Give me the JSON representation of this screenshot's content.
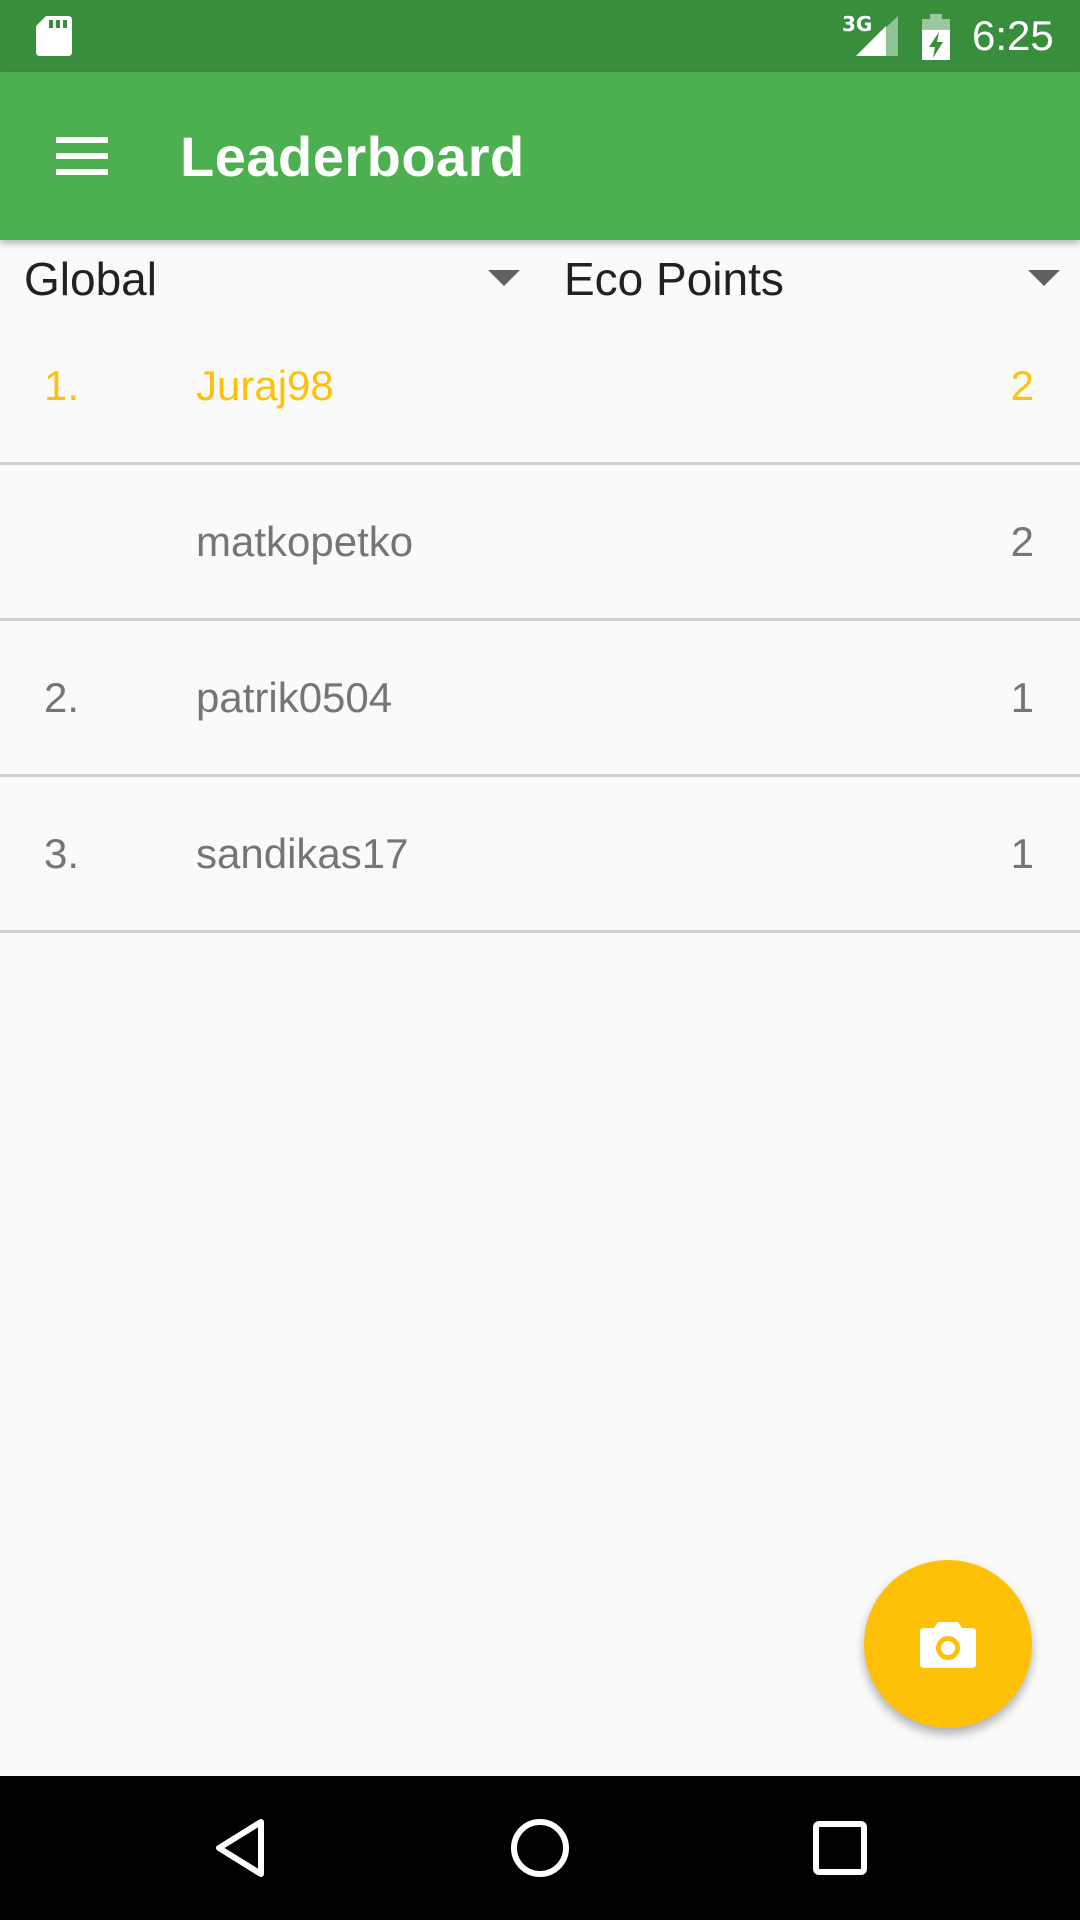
{
  "status_bar": {
    "network_type": "3G",
    "time": "6:25",
    "icons": [
      "sd-card-icon",
      "signal-icon",
      "battery-charging-icon"
    ]
  },
  "app_bar": {
    "title": "Leaderboard",
    "menu_icon": "menu-icon"
  },
  "filters": {
    "scope": {
      "selected": "Global"
    },
    "metric": {
      "selected": "Eco Points"
    }
  },
  "leaderboard": {
    "rows": [
      {
        "rank": "1.",
        "username": "Juraj98",
        "points": "2",
        "highlighted": true
      },
      {
        "rank": "",
        "username": "matkopetko",
        "points": "2",
        "highlighted": false
      },
      {
        "rank": "2.",
        "username": "patrik0504",
        "points": "1",
        "highlighted": false
      },
      {
        "rank": "3.",
        "username": "sandikas17",
        "points": "1",
        "highlighted": false
      }
    ]
  },
  "fab": {
    "icon": "camera-icon"
  },
  "navigation_bar": {
    "buttons": [
      "back-icon",
      "home-icon",
      "recents-icon"
    ]
  },
  "colors": {
    "status_bar": "#388e3c",
    "app_bar": "#4caf50",
    "accent": "#ffc107",
    "background": "#fafafa",
    "row_text": "#757575"
  }
}
